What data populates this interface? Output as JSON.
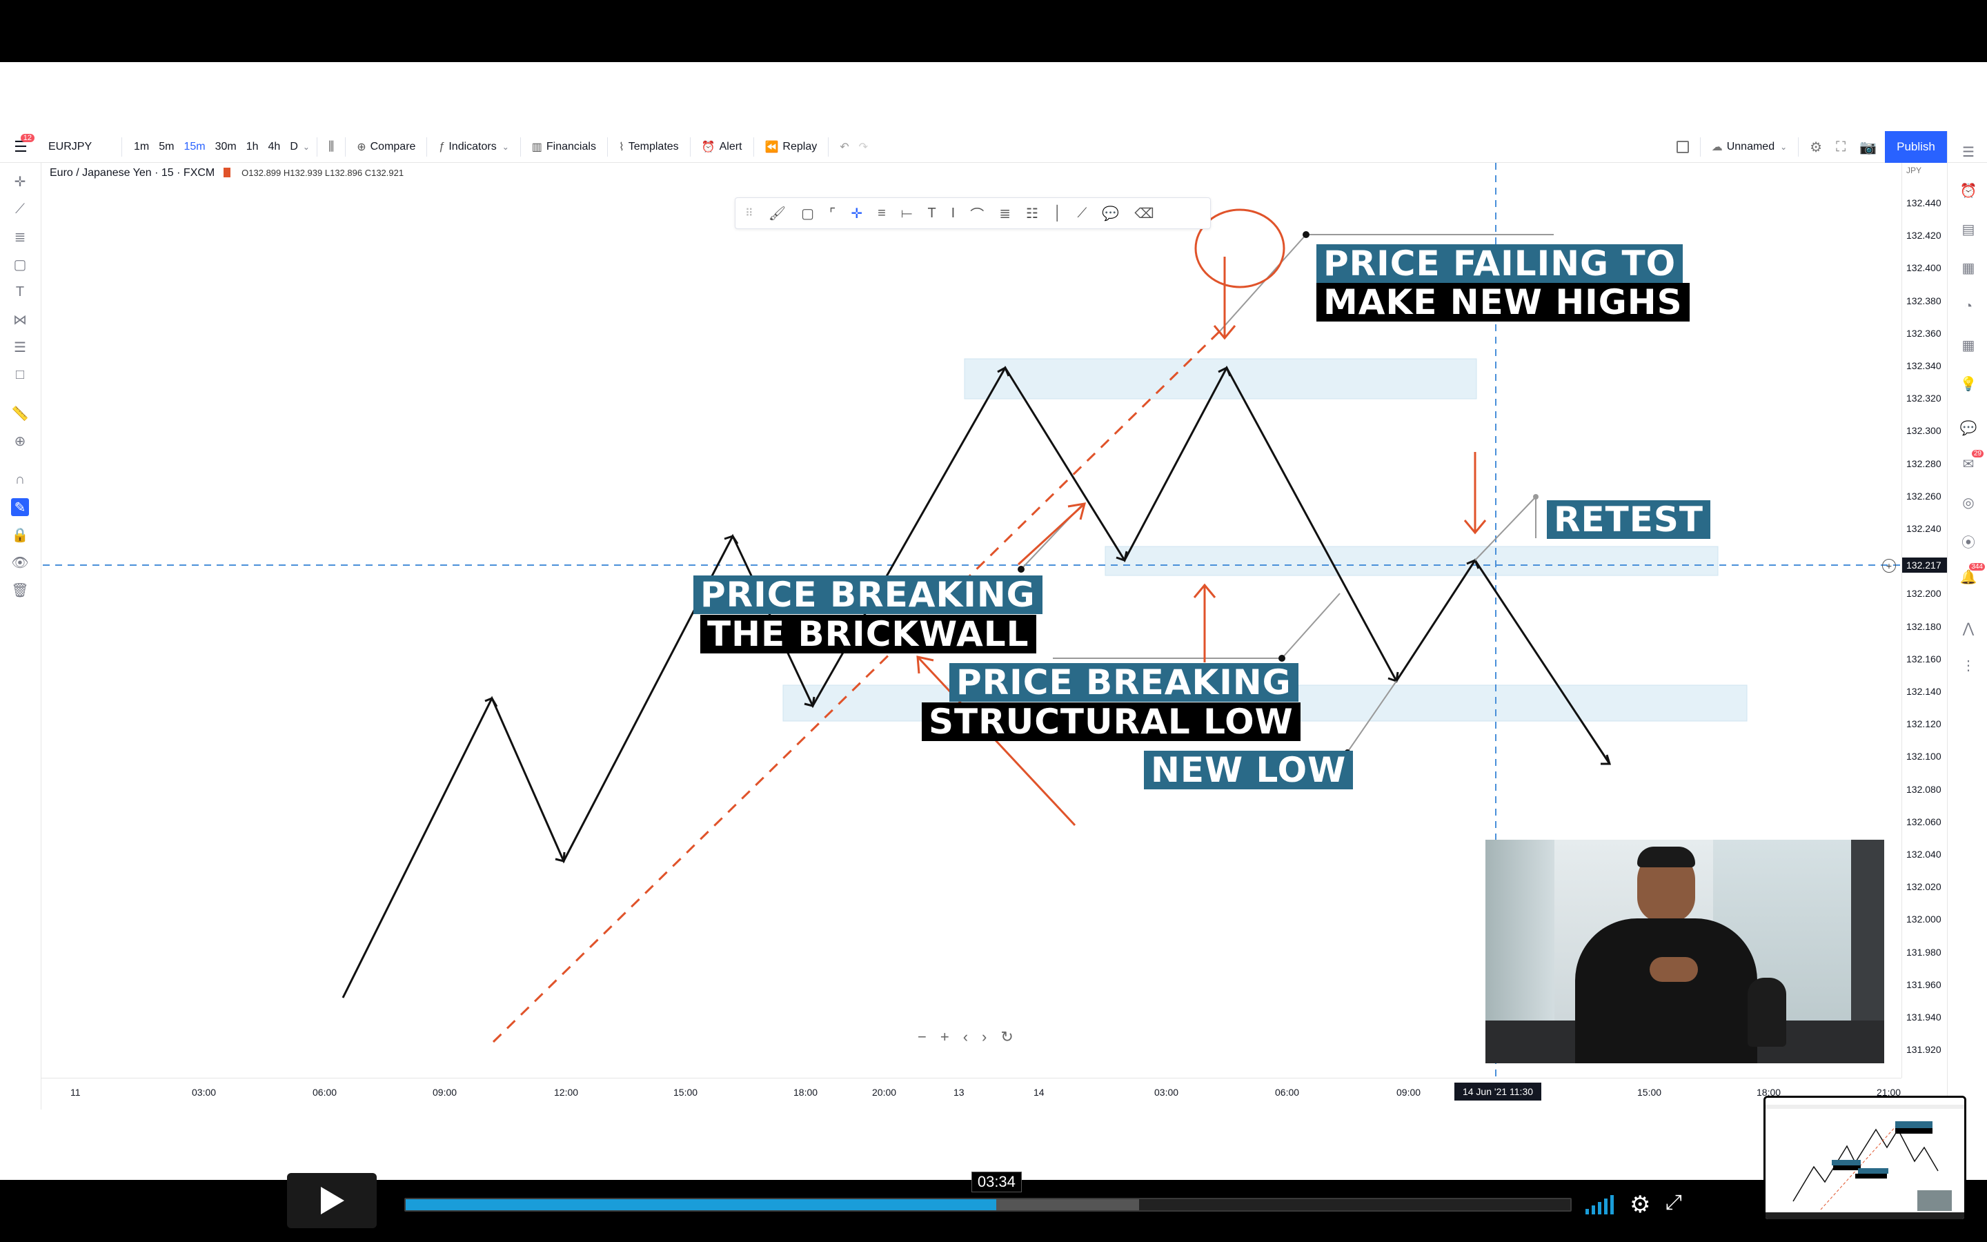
{
  "colors": {
    "accent": "#2962ff",
    "caption_teal": "#2a6a88",
    "caption_black": "#000000",
    "annotation_red": "#e0532a",
    "zone_blue": "#e4f1f8",
    "crosshair": "#4a90d9",
    "progress": "#1a9dd9"
  },
  "toolbar": {
    "notification_badge": "12",
    "symbol": "EURJPY",
    "timeframes": [
      "1m",
      "5m",
      "15m",
      "30m",
      "1h",
      "4h",
      "D"
    ],
    "active_timeframe": "15m",
    "compare": "Compare",
    "indicators": "Indicators",
    "financials": "Financials",
    "templates": "Templates",
    "alert": "Alert",
    "replay": "Replay",
    "layout_name": "Unnamed",
    "publish": "Publish"
  },
  "symbol_info": {
    "title": "Euro / Japanese Yen · 15 · FXCM",
    "ohlc": "O132.899 H132.939 L132.896 C132.921"
  },
  "price_axis": {
    "currency": "JPY",
    "labels": [
      "132.440",
      "132.420",
      "132.400",
      "132.380",
      "132.360",
      "132.340",
      "132.320",
      "132.300",
      "132.280",
      "132.260",
      "132.240",
      "132.220",
      "132.200",
      "132.180",
      "132.160",
      "132.140",
      "132.120",
      "132.100",
      "132.080",
      "132.060",
      "132.040",
      "132.020",
      "132.000",
      "131.980",
      "131.960",
      "131.940",
      "131.920"
    ],
    "current_price": "132.217"
  },
  "time_axis": {
    "labels": [
      "11",
      "03:00",
      "06:00",
      "09:00",
      "12:00",
      "15:00",
      "18:00",
      "20:00",
      "13",
      "14",
      "03:00",
      "06:00",
      "09:00",
      "15:00",
      "18:00",
      "21:00"
    ],
    "crosshair_label": "14 Jun '21  11:30"
  },
  "right_badges": {
    "chat": "29",
    "alerts": "344"
  },
  "captions": {
    "failing_1": "PRICE FAILING TO",
    "failing_2": "MAKE NEW HIGHS",
    "retest": "RETEST",
    "brickwall_1": "PRICE BREAKING",
    "brickwall_2": "THE BRICKWALL",
    "structural_1": "PRICE BREAKING",
    "structural_2": "STRUCTURAL LOW",
    "new_low": "NEW LOW"
  },
  "player": {
    "current_time": "03:34",
    "progress": 0.507,
    "buffered": 0.63
  }
}
